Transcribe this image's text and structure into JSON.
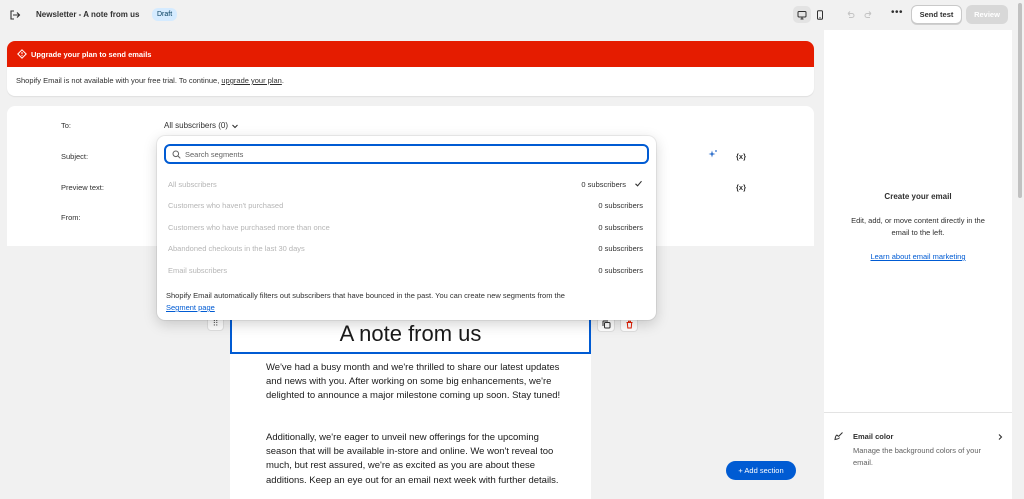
{
  "header": {
    "title": "Newsletter - A note from us",
    "status_badge": "Draft",
    "more_label": "•••",
    "send_test_label": "Send test",
    "review_label": "Review"
  },
  "alert": {
    "title": "Upgrade your plan to send emails",
    "body_text": "Shopify Email is not available with your free trial. To continue, ",
    "link_text": "upgrade your plan",
    "body_end": ".",
    "color": "#e51c00"
  },
  "settings": {
    "to_label": "To:",
    "to_value": "All subscribers (0)",
    "subject_label": "Subject:",
    "preview_label": "Preview text:",
    "from_label": "From:",
    "variable_icon_text": "{x}"
  },
  "segments_dropdown": {
    "search_placeholder": "Search segments",
    "items": [
      {
        "name": "All subscribers",
        "count": "0 subscribers",
        "selected": true
      },
      {
        "name": "Customers who haven't purchased",
        "count": "0 subscribers",
        "selected": false
      },
      {
        "name": "Customers who have purchased more than once",
        "count": "0 subscribers",
        "selected": false
      },
      {
        "name": "Abandoned checkouts in the last 30 days",
        "count": "0 subscribers",
        "selected": false
      },
      {
        "name": "Email subscribers",
        "count": "0 subscribers",
        "selected": false
      }
    ],
    "footer_text": "Shopify Email automatically filters out subscribers that have bounced in the past. You can create new segments from the",
    "footer_link": "Segment page"
  },
  "email": {
    "heading": "A note from us",
    "drag_handle": "⠿",
    "paragraphs": [
      "We've had a busy month and we're thrilled to share our latest updates and news with you. After working on some big enhancements, we're delighted to announce a major milestone coming up soon. Stay tuned!",
      "Additionally, we're eager to unveil new offerings for the upcoming season that will be available in-store and online. We won't reveal too much, but rest assured, we're as excited as you are about these additions. Keep an eye out for an email next week with further details."
    ],
    "add_section_label": "+ Add section"
  },
  "right_panel": {
    "title": "Create your email",
    "description": "Edit, add, or move content directly in the email to the left.",
    "link": "Learn about email marketing",
    "email_color_title": "Email color",
    "email_color_desc": "Manage the background colors of your email."
  },
  "colors": {
    "accent": "#005bd3",
    "alert_red": "#e51c00",
    "badge_bg": "#d5ebff"
  }
}
